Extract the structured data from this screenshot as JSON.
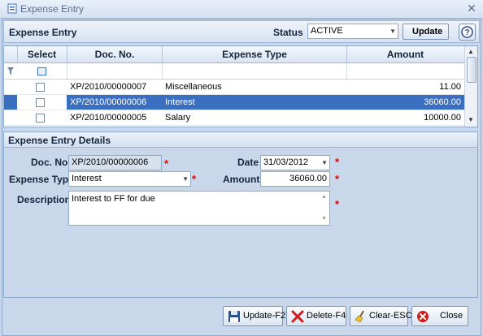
{
  "window": {
    "title": "Expense Entry"
  },
  "header": {
    "title": "Expense Entry",
    "status_label": "Status",
    "status_value": "ACTIVE",
    "update_label": "Update"
  },
  "grid": {
    "columns": [
      "Select",
      "Doc. No.",
      "Expense Type",
      "Amount"
    ],
    "rows": [
      {
        "doc_no": "XP/2010/00000007",
        "expense_type": "Miscellaneous",
        "amount": "11.00",
        "selected": false
      },
      {
        "doc_no": "XP/2010/00000006",
        "expense_type": "Interest",
        "amount": "36060.00",
        "selected": true
      },
      {
        "doc_no": "XP/2010/00000005",
        "expense_type": "Salary",
        "amount": "10000.00",
        "selected": false
      }
    ]
  },
  "details": {
    "title": "Expense Entry Details",
    "doc_no_label": "Doc. No.",
    "doc_no_value": "XP/2010/00000006",
    "date_label": "Date",
    "date_value": "31/03/2012",
    "expense_type_label": "Expense Type",
    "expense_type_value": "Interest",
    "amount_label": "Amount",
    "amount_value": "36060.00",
    "description_label": "Description",
    "description_value": "Interest to FF for due",
    "required_mark": "*"
  },
  "footer": {
    "update_label": "Update-F2",
    "delete_label": "Delete-F4",
    "clear_label": "Clear-ESC",
    "close_label": "Close"
  },
  "colors": {
    "selection": "#3a6ec1",
    "required": "#e00000",
    "panel": "#c9d7ea"
  }
}
